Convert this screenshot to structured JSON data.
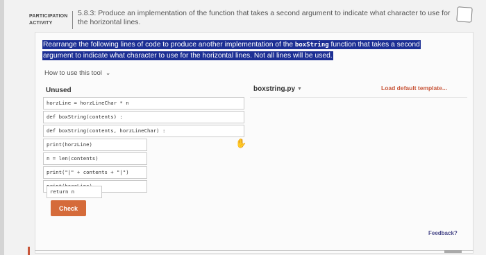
{
  "header": {
    "activity_label": "PARTICIPATION ACTIVITY",
    "activity_title": "5.8.3: Produce an implementation of the function that takes a second argument to indicate what character to use for the horizontal lines."
  },
  "instructions": {
    "text_before": "Rearrange the following lines of code to produce another implementation of the ",
    "code_word": "boxString",
    "text_after": " function that takes a second argument to indicate what character to use for the horizontal lines. Not all lines will be used."
  },
  "how_to_use": "How to use this tool",
  "unused": {
    "title": "Unused",
    "lines": [
      "horzLine = horzLineChar * n",
      "def boxString(contents) :",
      "def boxString(contents, horzLineChar) :",
      "print(horzLine)",
      "n = len(contents)",
      "print(\"|\" + contents + \"|\")",
      "print(horzLine)",
      "return n"
    ]
  },
  "check_button": "Check",
  "target": {
    "file_name": "boxstring.py",
    "load_default": "Load default template..."
  },
  "feedback": "Feedback?",
  "colors": {
    "highlight": "#1c2f94",
    "accent": "#d56b3a",
    "link": "#c8563a"
  }
}
